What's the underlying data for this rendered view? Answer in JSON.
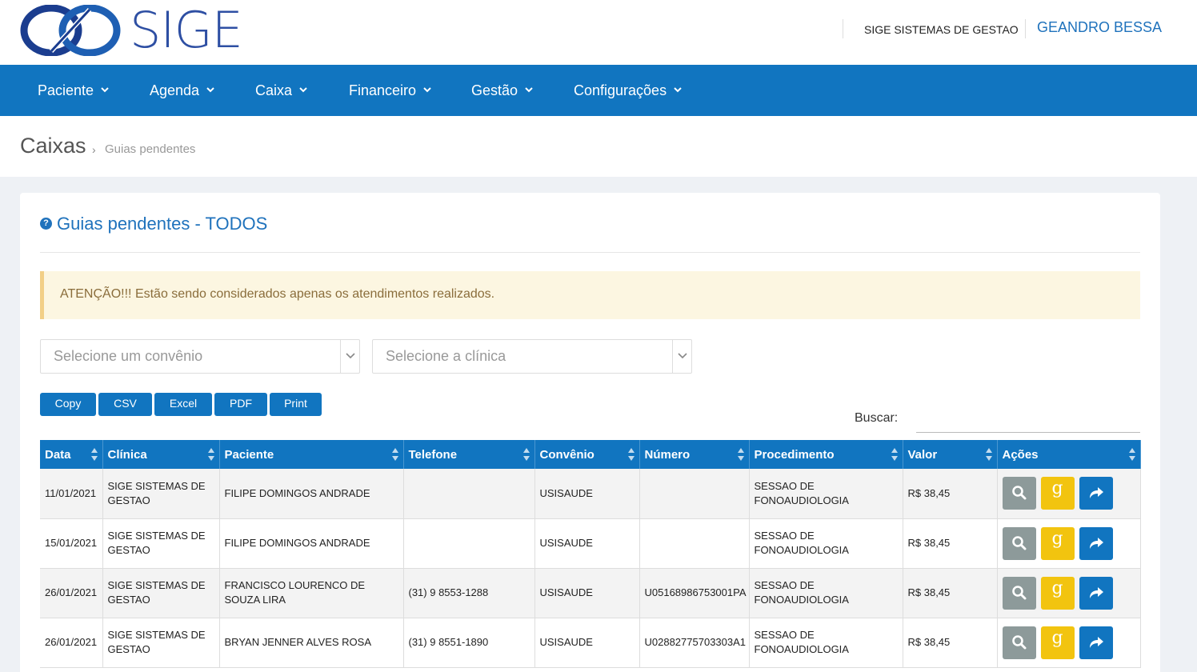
{
  "brand": {
    "logo_text": "SIGE",
    "company": "SIGE SISTEMAS DE GESTAO",
    "user": "GEANDRO BESSA",
    "accent": "#1175c0"
  },
  "nav": [
    "Paciente",
    "Agenda",
    "Caixa",
    "Financeiro",
    "Gestão",
    "Configurações"
  ],
  "breadcrumb": {
    "title": "Caixas",
    "separator": "›",
    "current": "Guias pendentes"
  },
  "card": {
    "title": "Guias pendentes - TODOS",
    "alert": "ATENÇÃO!!! Estão sendo considerados apenas os atendimentos realizados."
  },
  "filters": {
    "convenio_placeholder": "Selecione um convênio",
    "clinica_placeholder": "Selecione a clínica"
  },
  "export_buttons": [
    "Copy",
    "CSV",
    "Excel",
    "PDF",
    "Print"
  ],
  "search": {
    "label": "Buscar:",
    "value": ""
  },
  "table": {
    "headers": [
      "Data",
      "Clínica",
      "Paciente",
      "Telefone",
      "Convênio",
      "Número",
      "Procedimento",
      "Valor",
      "Ações"
    ],
    "rows": [
      [
        "11/01/2021",
        "SIGE SISTEMAS DE GESTAO",
        "FILIPE DOMINGOS ANDRADE",
        "",
        "USISAUDE",
        "",
        "SESSAO DE FONOAUDIOLOGIA",
        "R$ 38,45"
      ],
      [
        "15/01/2021",
        "SIGE SISTEMAS DE GESTAO",
        "FILIPE DOMINGOS ANDRADE",
        "",
        "USISAUDE",
        "",
        "SESSAO DE FONOAUDIOLOGIA",
        "R$ 38,45"
      ],
      [
        "26/01/2021",
        "SIGE SISTEMAS DE GESTAO",
        "FRANCISCO LOURENCO DE SOUZA LIRA",
        "(31) 9 8553-1288",
        "USISAUDE",
        "U05168986753001PA",
        "SESSAO DE FONOAUDIOLOGIA",
        "R$ 38,45"
      ],
      [
        "26/01/2021",
        "SIGE SISTEMAS DE GESTAO",
        "BRYAN JENNER ALVES ROSA",
        "(31) 9 8551-1890",
        "USISAUDE",
        "U02882775703303A1",
        "SESSAO DE FONOAUDIOLOGIA",
        "R$ 38,45"
      ]
    ],
    "actions": {
      "view_icon": "search-icon",
      "g_label": "g",
      "forward_icon": "share-icon"
    }
  }
}
